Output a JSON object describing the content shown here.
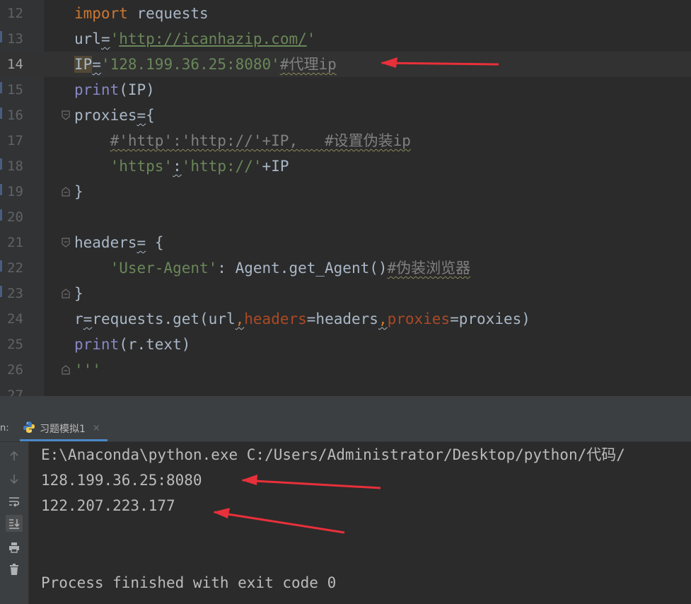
{
  "editor": {
    "lines": [
      {
        "no": "12",
        "parts": [
          {
            "t": "import",
            "c": "kw"
          },
          {
            "t": " requests",
            "c": "ident"
          }
        ]
      },
      {
        "no": "13",
        "parts": [
          {
            "t": "url",
            "c": "ident"
          },
          {
            "t": "=",
            "c": "ident squig"
          },
          {
            "t": "'",
            "c": "str"
          },
          {
            "t": "http://icanhazip.com/",
            "c": "url"
          },
          {
            "t": "'",
            "c": "str"
          }
        ]
      },
      {
        "no": "14",
        "current": true,
        "parts": [
          {
            "t": "IP",
            "c": "ident ip-highlight"
          },
          {
            "t": "=",
            "c": "ident squig"
          },
          {
            "t": "'128.199.36.25:8080'",
            "c": "str"
          },
          {
            "t": "#代理ip",
            "c": "cmt squig-c"
          }
        ]
      },
      {
        "no": "15",
        "parts": [
          {
            "t": "print",
            "c": "builtin"
          },
          {
            "t": "(IP)",
            "c": "ident"
          }
        ]
      },
      {
        "no": "16",
        "fold": "open",
        "parts": [
          {
            "t": "proxies",
            "c": "ident"
          },
          {
            "t": "=",
            "c": "ident squig"
          },
          {
            "t": "{",
            "c": "ident"
          }
        ]
      },
      {
        "no": "17",
        "parts": [
          {
            "t": "    ",
            "c": "ident"
          },
          {
            "t": "#'http':'http://'+IP,   #设置伪装ip",
            "c": "cmt squig-c"
          }
        ]
      },
      {
        "no": "18",
        "parts": [
          {
            "t": "    ",
            "c": "ident"
          },
          {
            "t": "'https'",
            "c": "str"
          },
          {
            "t": ":",
            "c": "ident squig"
          },
          {
            "t": "'http://'",
            "c": "str"
          },
          {
            "t": "+IP",
            "c": "ident"
          }
        ]
      },
      {
        "no": "19",
        "fold": "close",
        "parts": [
          {
            "t": "}",
            "c": "ident"
          }
        ]
      },
      {
        "no": "20",
        "parts": []
      },
      {
        "no": "21",
        "fold": "open",
        "parts": [
          {
            "t": "headers",
            "c": "ident"
          },
          {
            "t": "=",
            "c": "ident squig"
          },
          {
            "t": " {",
            "c": "ident"
          }
        ]
      },
      {
        "no": "22",
        "parts": [
          {
            "t": "    ",
            "c": "ident"
          },
          {
            "t": "'User-Agent'",
            "c": "str"
          },
          {
            "t": ": Agent.get_Agent()",
            "c": "ident"
          },
          {
            "t": "#伪装浏览器",
            "c": "cmt squig-c"
          }
        ]
      },
      {
        "no": "23",
        "fold": "close",
        "parts": [
          {
            "t": "}",
            "c": "ident"
          }
        ]
      },
      {
        "no": "24",
        "parts": [
          {
            "t": "r",
            "c": "ident"
          },
          {
            "t": "=",
            "c": "ident squig"
          },
          {
            "t": "requests.get(url",
            "c": "ident"
          },
          {
            "t": ",",
            "c": "kw squig"
          },
          {
            "t": "headers",
            "c": "param"
          },
          {
            "t": "=headers",
            "c": "ident"
          },
          {
            "t": ",",
            "c": "kw squig"
          },
          {
            "t": "proxies",
            "c": "param"
          },
          {
            "t": "=proxies)",
            "c": "ident"
          }
        ]
      },
      {
        "no": "25",
        "parts": [
          {
            "t": "print",
            "c": "builtin"
          },
          {
            "t": "(r.text)",
            "c": "ident"
          }
        ]
      },
      {
        "no": "26",
        "fold": "close",
        "parts": [
          {
            "t": "'''",
            "c": "str"
          }
        ]
      },
      {
        "no": "27",
        "parts": []
      }
    ]
  },
  "run_window": {
    "prefix": "n:",
    "tab_label": "习题模拟1",
    "tab_close": "×",
    "toolbar": [
      {
        "name": "up-arrow-icon",
        "active": false
      },
      {
        "name": "down-arrow-icon",
        "active": false
      },
      {
        "name": "soft-wrap-icon",
        "active": false
      },
      {
        "name": "scroll-to-end-icon",
        "active": true
      },
      {
        "name": "print-icon",
        "active": false
      },
      {
        "name": "trash-icon",
        "active": false
      }
    ],
    "console_lines": [
      "E:\\Anaconda\\python.exe C:/Users/Administrator/Desktop/python/代码/",
      "128.199.36.25:8080",
      "122.207.223.177",
      "",
      "Process finished with exit code 0"
    ]
  },
  "colors": {
    "keyword": "#cc7832",
    "string": "#6a8759",
    "comment": "#808080",
    "param": "#aa4926",
    "builtin": "#8888c6",
    "default": "#a9b7c6",
    "annotation_arrow": "#e8303a"
  }
}
